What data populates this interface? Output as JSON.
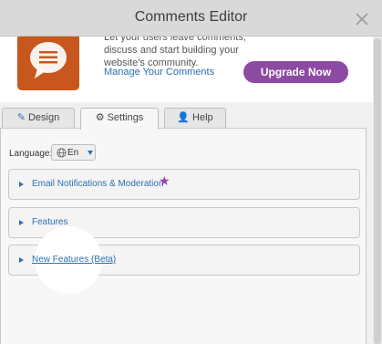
{
  "header": {
    "title": "Comments Editor"
  },
  "banner": {
    "description": "Let your users leave comments, discuss and start building your website's community.",
    "manage_link": "Manage Your Comments",
    "upgrade_button": "Upgrade Now"
  },
  "tabs": [
    {
      "label": "Design",
      "icon": "brush-icon"
    },
    {
      "label": "Settings",
      "icon": "gear-icon"
    },
    {
      "label": "Help",
      "icon": "user-icon"
    }
  ],
  "settings": {
    "language_label": "Language:",
    "language_value": "En",
    "sections": [
      {
        "label": "Email Notifications & Moderation",
        "badge": "★"
      },
      {
        "label": "Features"
      },
      {
        "label": "New Features (Beta)"
      }
    ]
  },
  "colors": {
    "accent_link": "#2b6fb3",
    "upgrade_button": "#8c4aa3",
    "app_icon_bg": "#c8571e",
    "star_badge": "#9b3fb5"
  }
}
